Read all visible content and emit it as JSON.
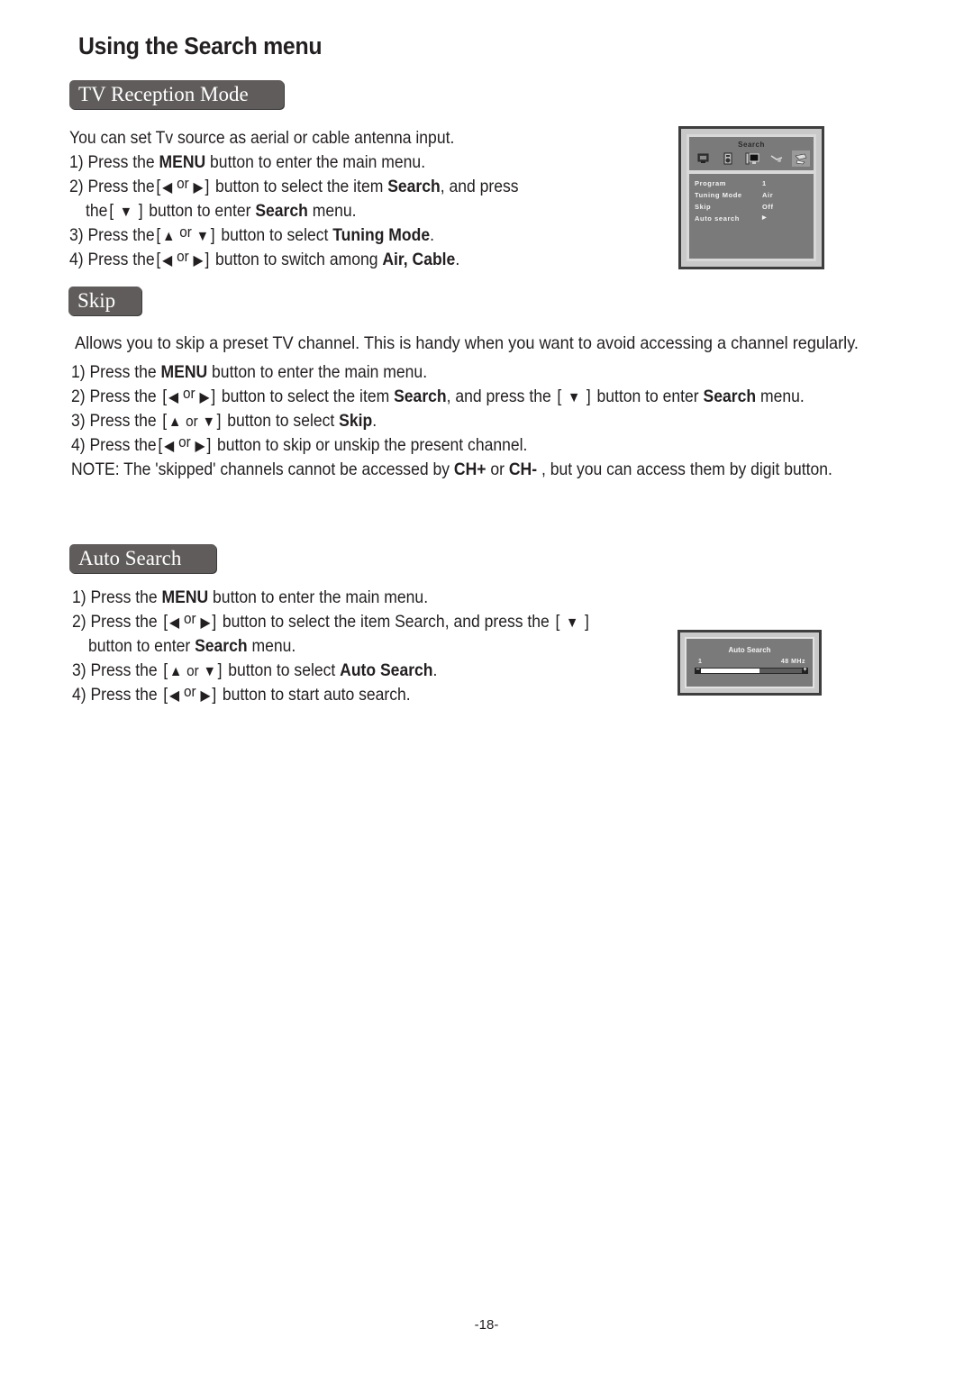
{
  "page": {
    "title": "Using the Search  menu",
    "page_number": "-18-"
  },
  "glyphs": {
    "left": "◀",
    "right": "▶",
    "up": "▲",
    "down": "▼",
    "or": "or",
    "open": "[",
    "close": "]"
  },
  "tv_reception": {
    "tag": "TV Reception Mode",
    "intro": "You can set Tv source as aerial or cable antenna input.",
    "s1_pre": "1) Press the ",
    "s1_bold": "MENU",
    "s1_post": " button to enter the main menu.",
    "s2_pre": "2) Press the",
    "s2_mid": " button to select the item ",
    "s2_bold": "Search",
    "s2_post": ", and press",
    "s2b_pre": "the",
    "s2b_mid": " button to enter ",
    "s2b_bold": "Search",
    "s2b_post": " menu.",
    "s3_pre": "3) Press the",
    "s3_mid": " button to select ",
    "s3_bold": "Tuning Mode",
    "s3_post": ".",
    "s4_pre": "4) Press the",
    "s4_mid": " button to switch among ",
    "s4_bold": "Air, Cable",
    "s4_post": "."
  },
  "skip": {
    "tag": "Skip",
    "intro": "Allows you to skip a preset TV channel. This is handy when you want to avoid accessing a channel regularly.",
    "s1_pre": "1) Press the ",
    "s1_bold": "MENU",
    "s1_post": " button to enter the main menu.",
    "s2_pre": "2) Press the",
    "s2_mid": " button to select the item  ",
    "s2_bold": "Search",
    "s2_mid2": ", and press the ",
    "s2_mid3": " button to enter ",
    "s2_bold2": "Search",
    "s2_post": " menu.",
    "s3_pre": "3) Press the",
    "s3_mid": " button to select ",
    "s3_bold": "Skip",
    "s3_post": ".",
    "s4_pre": "4) Press the",
    "s4_mid": " button to skip or unskip the present channel.",
    "note_pre": "NOTE: The 'skipped' channels cannot be accessed by ",
    "note_b1": "CH+",
    "note_mid": " or ",
    "note_b2": "CH-",
    "note_post": " , but you can access them by digit button."
  },
  "auto_search": {
    "tag": "Auto Search",
    "s1_pre": "1) Press the ",
    "s1_bold": "MENU",
    "s1_post": " button to enter the main menu.",
    "s2_pre": "2) Press the",
    "s2_mid": " button to select the item Search, and press the ",
    "s2b_pre": "button to enter ",
    "s2b_bold": "Search",
    "s2b_post": " menu.",
    "s3_pre": "3) Press the",
    "s3_mid": " button to select  ",
    "s3_bold": "Auto Search",
    "s3_post": ".",
    "s4_pre": "4) Press the",
    "s4_mid": " button to start auto search."
  },
  "osd_search": {
    "title": "Search",
    "icons": [
      "tv-picture-icon",
      "sound-icon",
      "pc-monitor-icon",
      "setup-tools-icon",
      "search-antenna-icon"
    ],
    "active_icon": 4,
    "rows": [
      {
        "label": "Program",
        "value": "1"
      },
      {
        "label": "Tuning Mode",
        "value": "Air"
      },
      {
        "label": "Skip",
        "value": "Off"
      },
      {
        "label": "Auto search",
        "value": "▶"
      }
    ]
  },
  "osd_auto": {
    "title": "Auto Search",
    "min_label": "1",
    "max_label": "48  MHz",
    "minus": "−",
    "plus": "+",
    "progress": 0.58
  }
}
